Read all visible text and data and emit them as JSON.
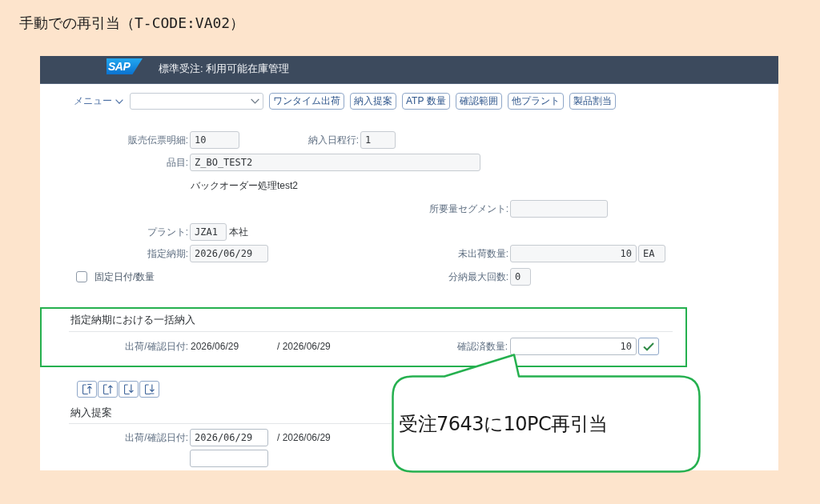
{
  "page_title": "手動での再引当（T-CODE:VA02）",
  "window": {
    "logo": "SAP",
    "title": "標準受注: 利用可能在庫管理"
  },
  "toolbar": {
    "menu": "メニュー",
    "buttons": [
      "ワンタイム出荷",
      "納入提案",
      "ATP 数量",
      "確認範囲",
      "他プラント",
      "製品割当"
    ]
  },
  "form": {
    "sales_document_item": {
      "label": "販売伝票明細:",
      "value": "10"
    },
    "schedule_line": {
      "label": "納入日程行:",
      "value": "1"
    },
    "material": {
      "label": "品目:",
      "value": "Z_BO_TEST2"
    },
    "material_description": "バックオーダー処理test2",
    "requirements_segment": {
      "label": "所要量セグメント:"
    },
    "plant": {
      "label": "プラント:",
      "value": "JZA1",
      "name": "本社"
    },
    "requested_delivery_date": {
      "label": "指定納期:",
      "value": "2026/06/29"
    },
    "open_quantity": {
      "label": "未出荷数量:",
      "value": "10",
      "unit": "EA"
    },
    "fixed_date_quantity": {
      "label": "固定日付/数量",
      "checked": false
    },
    "max_partial_deliveries": {
      "label": "分納最大回数:",
      "value": "0"
    }
  },
  "complete_delivery": {
    "title": "指定納期における一括納入",
    "date_label": "出荷/確認日付:",
    "date": "2026/06/29",
    "confirmed_date": "/ 2026/06/29",
    "confirmed_quantity": {
      "label": "確認済数量:",
      "value": "10"
    }
  },
  "page_buttons": [
    {
      "kind": "first"
    },
    {
      "kind": "previous"
    },
    {
      "kind": "next"
    },
    {
      "kind": "last"
    }
  ],
  "delivery_proposal": {
    "title": "納入提案",
    "date_label": "出荷/確認日付:",
    "date": "2026/06/29",
    "confirmed_date": "/ 2026/06/29"
  },
  "callout": {
    "text": "受注7643に10PC再引当"
  }
}
